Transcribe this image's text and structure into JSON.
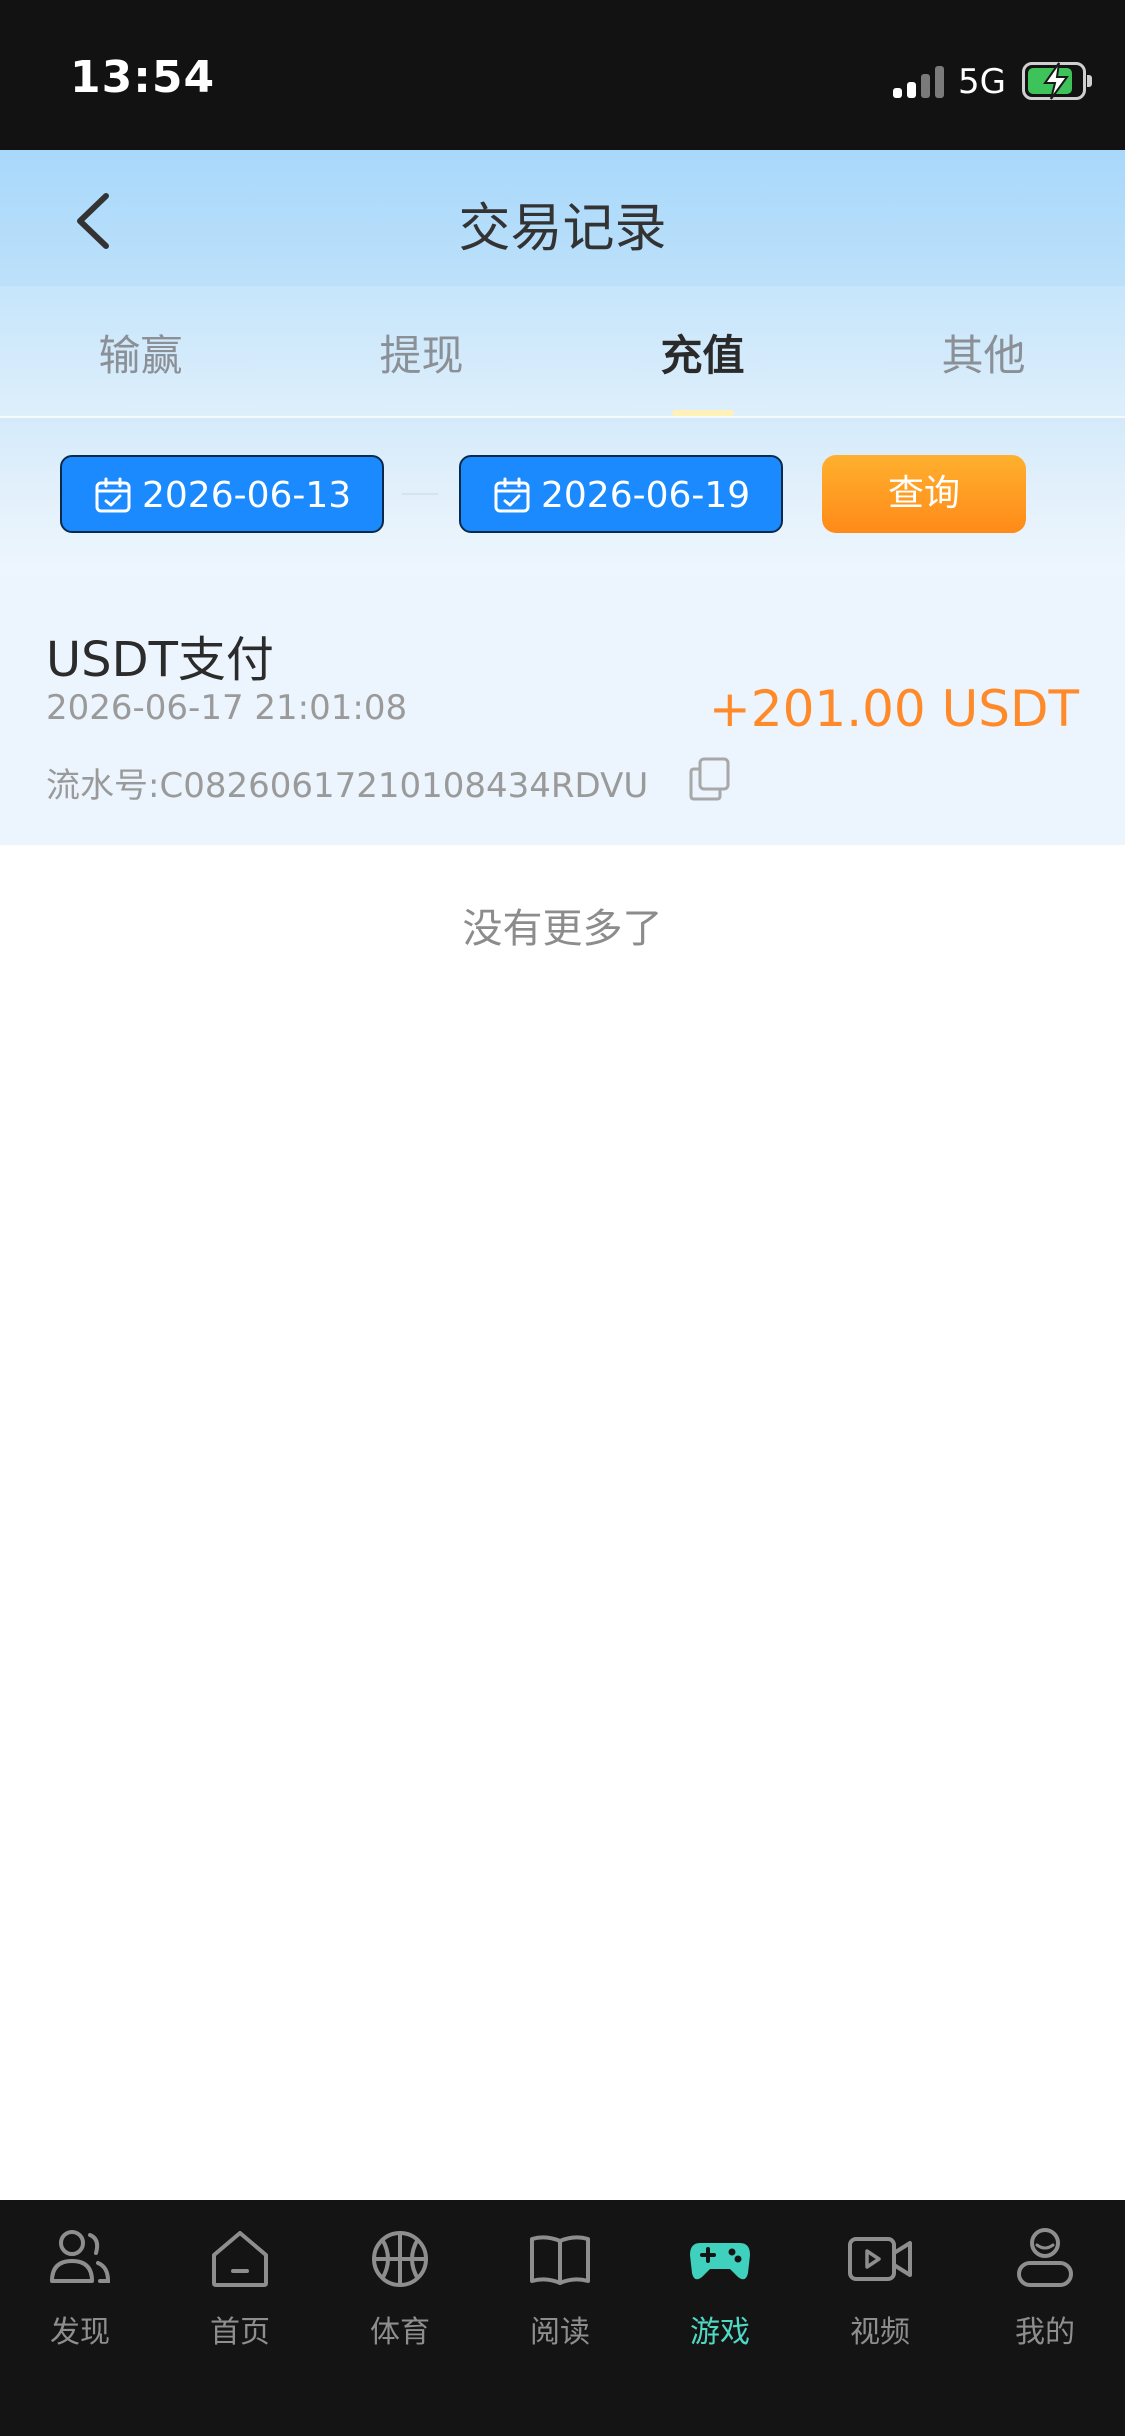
{
  "status_bar": {
    "time": "13:54",
    "network": "5G"
  },
  "header": {
    "title": "交易记录"
  },
  "tabs": [
    {
      "label": "输赢"
    },
    {
      "label": "提现"
    },
    {
      "label": "充值",
      "active": true
    },
    {
      "label": "其他"
    }
  ],
  "filter": {
    "start_date": "2026-06-13",
    "end_date": "2026-06-19",
    "query_label": "查询"
  },
  "records": [
    {
      "title": "USDT支付",
      "time": "2026-06-17 21:01:08",
      "serial": "流水号:C08260617210108434RDVU",
      "amount": "+201.00 USDT"
    }
  ],
  "list_end_text": "没有更多了",
  "bottom_nav": [
    {
      "label": "发现",
      "icon": "users-icon"
    },
    {
      "label": "首页",
      "icon": "home-icon"
    },
    {
      "label": "体育",
      "icon": "basketball-icon"
    },
    {
      "label": "阅读",
      "icon": "book-icon"
    },
    {
      "label": "游戏",
      "icon": "gamepad-icon",
      "active": true
    },
    {
      "label": "视频",
      "icon": "video-icon"
    },
    {
      "label": "我的",
      "icon": "profile-icon"
    }
  ],
  "colors": {
    "accent_blue": "#1b8aff",
    "query_orange": "#ff8a18",
    "amount_orange": "#ff8a2a",
    "active_nav_teal": "#4fd8c4"
  }
}
